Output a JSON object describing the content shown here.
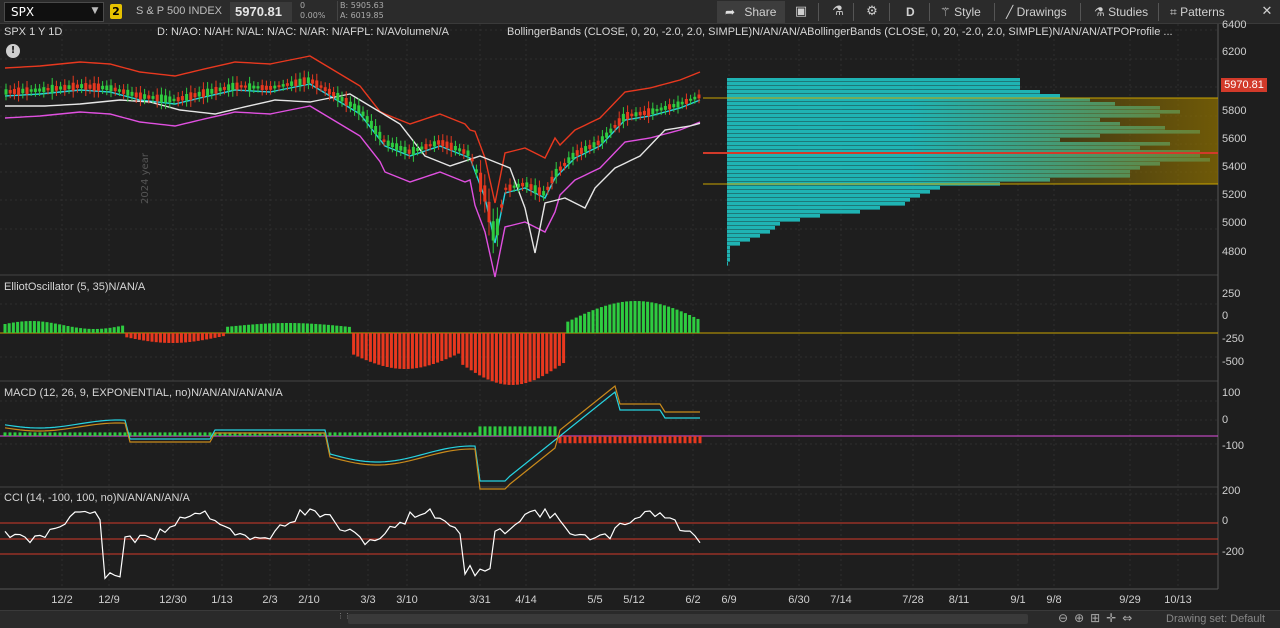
{
  "toolbar": {
    "symbol": "SPX",
    "link_group": "2",
    "description": "S & P 500 INDEX",
    "last_price": "5970.81",
    "change": "0",
    "change_pct": "0.00%",
    "bid": "B: 5905.63",
    "ask": "A: 6019.85",
    "share_label": "Share",
    "timeframe": "D",
    "style_label": "Style",
    "drawings_label": "Drawings",
    "studies_label": "Studies",
    "patterns_label": "Patterns"
  },
  "price_panel": {
    "title": "SPX 1 Y 1D",
    "data_line": "D: N/AO: N/AH: N/AL: N/AC: N/AR: N/AFPL: N/AVolumeN/A",
    "studies_line": "BollingerBands (CLOSE, 0, 20, -2.0, 2.0, SIMPLE)N/AN/AN/ABollingerBands (CLOSE, 0, 20, -2.0, 2.0, SIMPLE)N/AN/AN/ATPOProfile ...",
    "year_marker": "2024 year",
    "price_tag": "5970.81",
    "y_ticks": [
      "6400",
      "6200",
      "5800",
      "5600",
      "5400",
      "5200",
      "5000",
      "4800"
    ]
  },
  "elliot_panel": {
    "title": "ElliotOscillator (5, 35)N/AN/A",
    "y_ticks": [
      "250",
      "0",
      "-250",
      "-500"
    ]
  },
  "macd_panel": {
    "title": "MACD (12, 26, 9, EXPONENTIAL, no)N/AN/AN/AN/AN/A",
    "y_ticks": [
      "100",
      "0",
      "-100"
    ]
  },
  "cci_panel": {
    "title": "CCI (14, -100, 100, no)N/AN/AN/AN/A",
    "y_ticks": [
      "200",
      "0",
      "-200"
    ]
  },
  "x_axis": {
    "labels": [
      "12/2",
      "12/9",
      "12/30",
      "1/13",
      "2/3",
      "2/10",
      "3/3",
      "3/10",
      "3/31",
      "4/14",
      "5/5",
      "5/12",
      "6/2",
      "6/9",
      "6/30",
      "7/14",
      "7/28",
      "8/11",
      "9/1",
      "9/8",
      "9/29",
      "10/13"
    ]
  },
  "bottom_bar": {
    "drawing_set": "Drawing set: Default"
  },
  "colors": {
    "background": "#1e1e1e",
    "up_candle": "#2ecc40",
    "down_candle": "#e8381f",
    "bb_upper": "#e8381f",
    "bb_lower": "#e050e0",
    "bb_mid": "#27d3e0",
    "sma": "#e6e6e6",
    "profile": "#1fb3b3",
    "cci_line": "#ffffff"
  }
}
